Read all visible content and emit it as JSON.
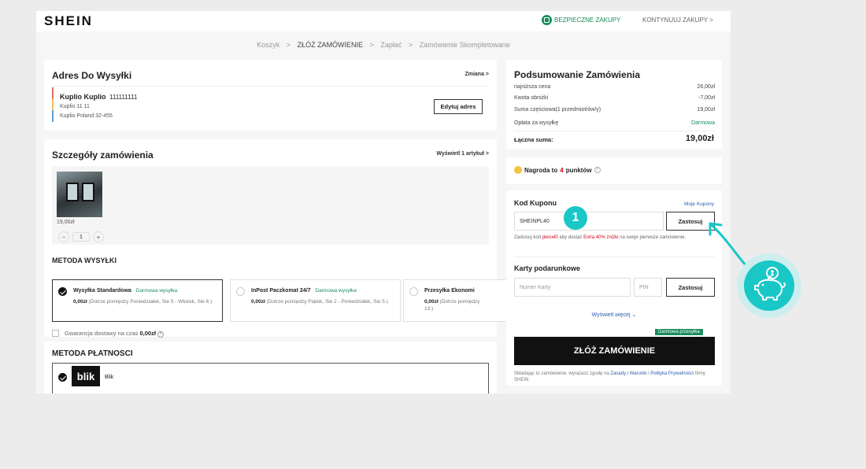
{
  "header": {
    "logo": "SHEIN",
    "secure_label": "BEZPIECZNE ZAKUPY",
    "continue_label": "KONTYNUUJ ZAKUPY >"
  },
  "breadcrumb": {
    "items": [
      "Koszyk",
      "ZŁÓŻ ZAMÓWIENIE",
      "Zapłać",
      "Zamówienie Skompletowane"
    ],
    "separator": ">"
  },
  "address": {
    "title": "Adres Do Wysyłki",
    "change_label": "Zmiana >",
    "name": "Kuplio Kuplio",
    "phone": "111111111",
    "line1": "Kuplio 11 11",
    "line2": "Kuplio Poland 32-455",
    "edit_label": "Edytuj adres"
  },
  "order_details": {
    "title": "Szczegóły zamówienia",
    "show_label": "Wyświetl 1 artykuł >",
    "item_price": "19,00zł",
    "qty": "1",
    "minus": "−",
    "plus": "+"
  },
  "shipping": {
    "title": "METODA WYSYŁKI",
    "options": [
      {
        "name": "Wysyłka Standardowa",
        "badge": "Darmowa wysyłka",
        "price": "0,00zł",
        "desc": "(Dotrze pomiędzy Poniedziałek, Sie 5 - Wtorek, Sie 6.)"
      },
      {
        "name": "InPost Paczkomat 24/7",
        "badge": "Darmowa wysyłka",
        "price": "0,00zł",
        "desc": "(Dotrze pomiędzy Piątek, Sie 2 - Poniedziałek, Sie 5.)"
      },
      {
        "name": "Przesyłka Ekonomi",
        "badge": "",
        "price": "0,00zł",
        "desc": "(Dotrze pomiędzy 13.)"
      }
    ],
    "guarantee_prefix": "Gwarancja dostawy na czas",
    "guarantee_price": "0,00zł"
  },
  "payment": {
    "title": "METODA PŁATNOSCI",
    "logo_text": "blik",
    "method": "Blik"
  },
  "summary": {
    "title": "Podsumowanie Zamówienia",
    "rows": [
      {
        "label": "najniższa cena",
        "value": "26,00zł"
      },
      {
        "label": "Kwota obniżki",
        "value": "-7,00zł"
      },
      {
        "label": "Suma częściowa(1 przedmiot/ów/y)",
        "value": "19,00zł"
      },
      {
        "label": "Opłata za wysyłkę",
        "value": "Darmowa"
      }
    ],
    "total_label": "Łączna suma:",
    "total_value": "19,00zł"
  },
  "reward": {
    "prefix": "Nagroda to",
    "points": "4",
    "suffix": "punktów"
  },
  "coupon": {
    "title": "Kod Kuponu",
    "my_coupons": "Moje Kupony",
    "value": "SHEINPL40",
    "apply_label": "Zastosuj",
    "note_prefix": "Zastosuj kod",
    "note_code": "pleru40",
    "note_mid": "aby dostać",
    "note_discount": "Extra 40% zniżki",
    "note_suffix": "na swoje pierwsze zamówienie."
  },
  "gift_card": {
    "title": "Karty podarunkowe",
    "card_placeholder": "Numer Karty",
    "pin_placeholder": "PIN",
    "apply_label": "Zastosuj"
  },
  "more_label": "Wyświetl więcej ⌄",
  "free_shipping_badge": "Darmowa przesyłka",
  "order_button": "ZŁÓŻ ZAMÓWIENIE",
  "terms": {
    "prefix": "Składając to zamówienie, wyrażasz zgodę na",
    "link1": "Zasady i Warunki",
    "and": "i",
    "link2": "Polityka Prywatności",
    "suffix": "firmy SHEIN."
  },
  "step_marker": "1"
}
